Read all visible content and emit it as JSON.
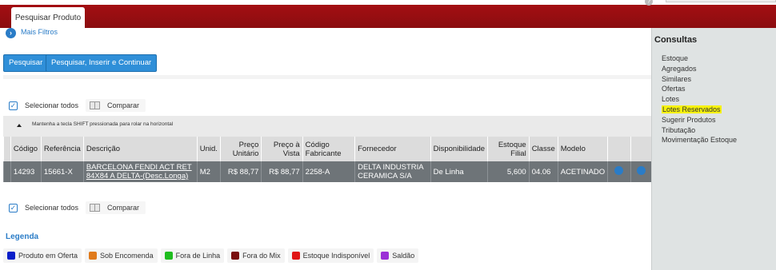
{
  "header": {
    "tab_label": "Pesquisar Produto",
    "help_icon": "?"
  },
  "filters": {
    "mais_filtros_label": "Mais Filtros",
    "icon": "chevron-right-circle-icon"
  },
  "actions": {
    "pesquisar_label": "Pesquisar",
    "pesquisar_inserir_label": "Pesquisar, Inserir e Continuar"
  },
  "selection": {
    "selecionar_todos_label": "Selecionar todos",
    "comparar_label": "Comparar",
    "checkmark": "✓"
  },
  "hint": {
    "text": "Mantenha a tecla SHIFT pressionada para rolar na horizontal"
  },
  "table": {
    "columns": [
      "Código",
      "Referência",
      "Descrição",
      "Unid.",
      "Preço Unitário",
      "Preço à Vista",
      "Código Fabricante",
      "Fornecedor",
      "Disponibilidade",
      "Estoque Filial",
      "Classe",
      "Modelo"
    ],
    "rows": [
      {
        "codigo": "14293",
        "referencia": "15661-X",
        "descricao": "BARCELONA FENDI ACT RET 84X84 A DELTA-(Desc.Longa)",
        "unid": "M2",
        "preco_unitario": "R$ 88,77",
        "preco_vista": "R$ 88,77",
        "codigo_fabricante": "2258-A",
        "fornecedor": "DELTA INDUSTRIA CERAMICA S/A",
        "disponibilidade": "De Linha",
        "estoque_filial": "5,600",
        "classe": "04.06",
        "modelo": "ACETINADO"
      }
    ]
  },
  "legend": {
    "title": "Legenda",
    "items": [
      {
        "label": "Produto em Oferta",
        "color": "#0a1fc9"
      },
      {
        "label": "Sob Encomenda",
        "color": "#e07a1a"
      },
      {
        "label": "Fora de Linha",
        "color": "#1fbd1f"
      },
      {
        "label": "Fora do Mix",
        "color": "#7a0d0d"
      },
      {
        "label": "Estoque Indisponível",
        "color": "#e01414"
      },
      {
        "label": "Saldão",
        "color": "#9b2fd6"
      }
    ]
  },
  "consultas": {
    "title": "Consultas",
    "items": [
      "Estoque",
      "Agregados",
      "Similares",
      "Ofertas",
      "Lotes",
      "Lotes Reservados",
      "Sugerir Produtos",
      "Tributação",
      "Movimentação Estoque"
    ],
    "highlighted_item": "Lotes Reservados"
  }
}
